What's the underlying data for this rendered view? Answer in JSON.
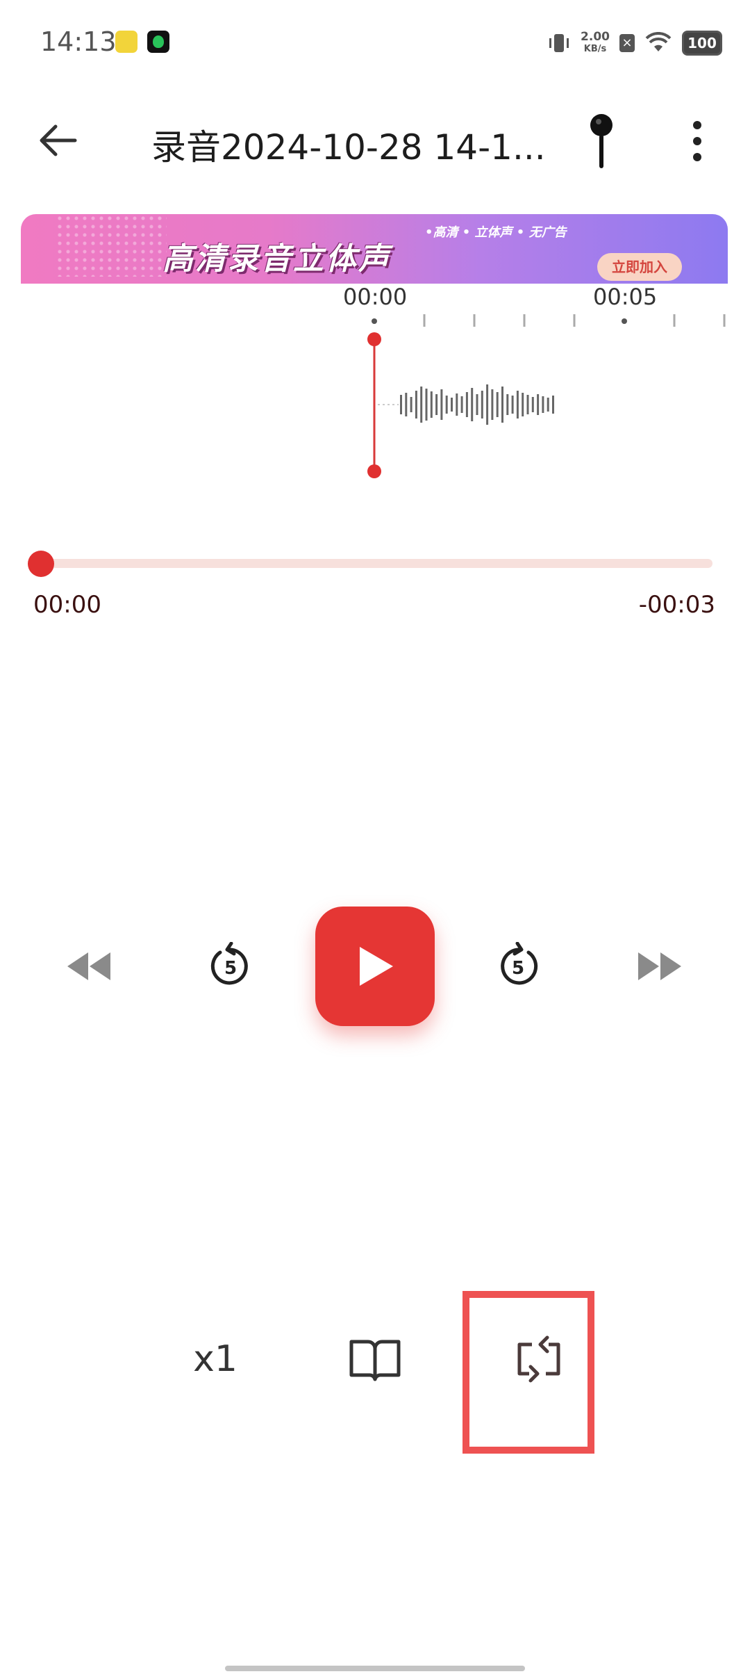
{
  "status_bar": {
    "time": "14:13",
    "network_speed_value": "2.00",
    "network_speed_unit": "KB/s",
    "battery": "100",
    "icons": [
      "vibrate-icon",
      "sim-off-icon",
      "wifi-icon",
      "battery-icon"
    ]
  },
  "header": {
    "title": "录音2024-10-28 14-1...",
    "back_icon": "arrow-left-icon",
    "mic_icon": "microphone-icon",
    "more_icon": "more-vertical-icon"
  },
  "banner": {
    "title": "高清录音立体声",
    "subtitle": "•高清 • 立体声 • 无广告",
    "button": "立即加入"
  },
  "timeline": {
    "tick_labels": [
      "00:00",
      "00:05"
    ]
  },
  "playback": {
    "current_time": "00:00",
    "remaining_time": "-00:03",
    "progress": 0
  },
  "controls": {
    "rewind_icon": "rewind-icon",
    "back5_label": "5",
    "play_icon": "play-icon",
    "forward5_label": "5",
    "fastforward_icon": "fast-forward-icon"
  },
  "tools": {
    "speed_label": "x1",
    "book_icon": "book-icon",
    "loop_icon": "repeat-icon"
  },
  "colors": {
    "accent": "#e53634",
    "progress_track": "#f7e0dc",
    "highlight": "#ee5252"
  }
}
